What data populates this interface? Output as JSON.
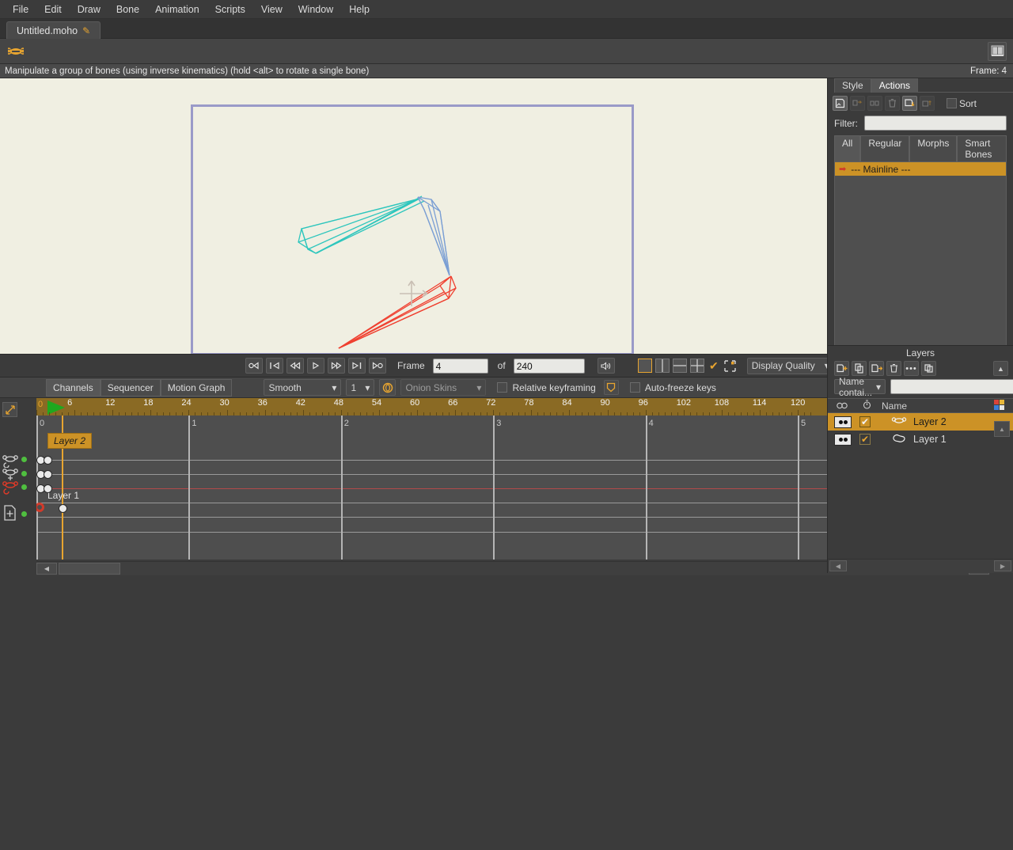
{
  "menu": {
    "items": [
      "File",
      "Edit",
      "Draw",
      "Bone",
      "Animation",
      "Scripts",
      "View",
      "Window",
      "Help"
    ]
  },
  "tab": {
    "title": "Untitled.moho",
    "modified_glyph": "✎"
  },
  "toolbar": {
    "tool_icon": "bone-icon",
    "right_icon": "book-icon"
  },
  "status": {
    "message": "Manipulate a group of bones (using inverse kinematics) (hold <alt> to rotate a single bone)",
    "frame_label": "Frame: 4"
  },
  "rightdock": {
    "tabs": [
      {
        "label": "Style",
        "active": false
      },
      {
        "label": "Actions",
        "active": true
      }
    ],
    "tools": [
      "new-action-icon",
      "duplicate-action-icon",
      "link-action-icon",
      "delete-action-icon",
      "insert-action-icon",
      "extract-action-icon"
    ],
    "sort_label": "Sort",
    "filter_label": "Filter:",
    "filter_value": "",
    "segments": [
      {
        "label": "All",
        "active": true
      },
      {
        "label": "Regular",
        "active": false
      },
      {
        "label": "Morphs",
        "active": false
      },
      {
        "label": "Smart Bones",
        "active": false
      }
    ],
    "actions": [
      {
        "label": "--- Mainline ---",
        "selected": true
      }
    ]
  },
  "playback": {
    "buttons": [
      "skip-to-start-icon",
      "jump-to-start-icon",
      "rewind-icon",
      "play-icon",
      "fast-forward-icon",
      "jump-to-end-icon",
      "skip-to-end-icon"
    ],
    "frame_label": "Frame",
    "frame_value": "4",
    "of_label": "of",
    "total_value": "240",
    "audio_icon": "speaker-icon",
    "view_buttons": [
      "single-view-icon",
      "two-view-icon",
      "split-horizontal-icon",
      "quad-view-icon"
    ],
    "checkbox_checked": true,
    "crop_icon": "crop-icon",
    "quality_label": "Display Quality"
  },
  "timeline_toolbar": {
    "modes": [
      {
        "label": "Channels",
        "active": true
      },
      {
        "label": "Sequencer",
        "active": false
      },
      {
        "label": "Motion Graph",
        "active": false
      }
    ],
    "interp_value": "Smooth",
    "count_value": "1",
    "onion_icon": "onion-skin-icon",
    "onion_label": "Onion Skins",
    "relative_label": "Relative keyframing",
    "relative_checked": false,
    "shield_icon": "shield-icon",
    "autofreeze_label": "Auto-freeze keys",
    "autofreeze_checked": false,
    "right_icons": [
      "ease-in-icon",
      "ease-both-icon"
    ]
  },
  "timeline": {
    "ruler_start": "0",
    "ruler_ticks": [
      "6",
      "12",
      "18",
      "24",
      "30",
      "36",
      "42",
      "48",
      "54",
      "60",
      "66",
      "72",
      "78",
      "84",
      "90",
      "96",
      "102",
      "108",
      "114",
      "120"
    ],
    "second_marks": [
      "0",
      "1",
      "2",
      "3",
      "4",
      "5"
    ],
    "current_frame": 4,
    "tracks": [
      {
        "name": "Layer 2",
        "type": "tag",
        "icons": [
          "bone-rotate-icon",
          "bone-translate-icon",
          "bone-red-icon"
        ]
      },
      {
        "name": "Layer 1",
        "type": "label",
        "icons": [
          "layer-transform-icon"
        ]
      }
    ]
  },
  "layers": {
    "title": "Layers",
    "tools": [
      "add-layer-icon",
      "duplicate-layer-icon",
      "export-layer-icon",
      "delete-layer-icon",
      "more-options-icon",
      "group-layers-icon"
    ],
    "collapse_icon": "chevron-up-icon",
    "search_mode": "Name contai...",
    "search_value": "",
    "columns": [
      "visibility-icon",
      "timing-icon",
      "Name",
      "color-swatch-icon"
    ],
    "rows": [
      {
        "name": "Layer 2",
        "icon": "bone-layer-icon",
        "selected": true,
        "visible": true,
        "checked": true
      },
      {
        "name": "Layer 1",
        "icon": "vector-layer-icon",
        "selected": false,
        "visible": true,
        "checked": true
      }
    ],
    "annotation_arrow": "up-arrow-annotation"
  },
  "colors": {
    "accent": "#cc9226",
    "canvas_bg": "#f0efe2",
    "canvas_border": "#9a9ac8",
    "bone_cyan": "#2ec6bd",
    "bone_blue": "#7b9fd4",
    "bone_red": "#ef4030",
    "ruler": "#8a6a24",
    "panel_bg": "#3b3b3b"
  }
}
